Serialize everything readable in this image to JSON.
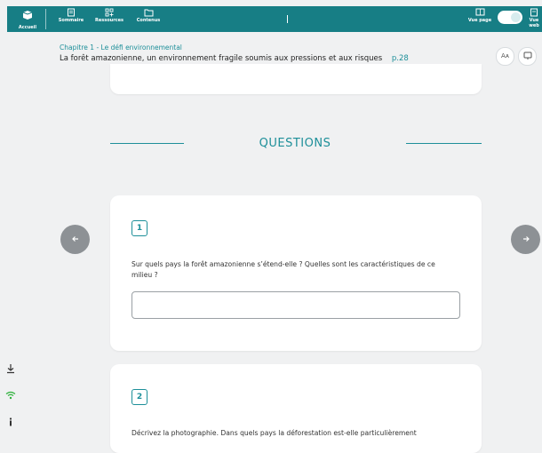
{
  "topbar": {
    "home_label": "Accueil",
    "nav": [
      {
        "label": "Sommaire",
        "icon": "book-icon"
      },
      {
        "label": "Ressources",
        "icon": "grid-icon"
      },
      {
        "label": "Contenus",
        "icon": "folder-icon"
      }
    ],
    "view_page_label": "Vue page",
    "view_web_label": "Vue web",
    "toggle_state": "on",
    "accent_color": "#177e85"
  },
  "header": {
    "chapter": "Chapitre 1 - Le défi environnemental",
    "title": "La forêt amazonienne, un environnement fragile soumis aux pressions et aux risques",
    "page": "p.28",
    "font_button": "Aᴀ"
  },
  "section": {
    "title": "QUESTIONS"
  },
  "questions": [
    {
      "number": "1",
      "text": "Sur quels pays la forêt amazonienne s’étend-elle ? Quelles sont les caractéristiques de ce milieu ?",
      "answer_value": ""
    },
    {
      "number": "2",
      "text": "Décrivez la photographie. Dans quels pays la déforestation est-elle particulièrement"
    }
  ],
  "navigation": {
    "prev_icon": "arrow-left-icon",
    "next_icon": "arrow-right-icon"
  },
  "sidebar": {
    "icons": [
      "download-icon",
      "wifi-icon",
      "info-icon"
    ]
  }
}
